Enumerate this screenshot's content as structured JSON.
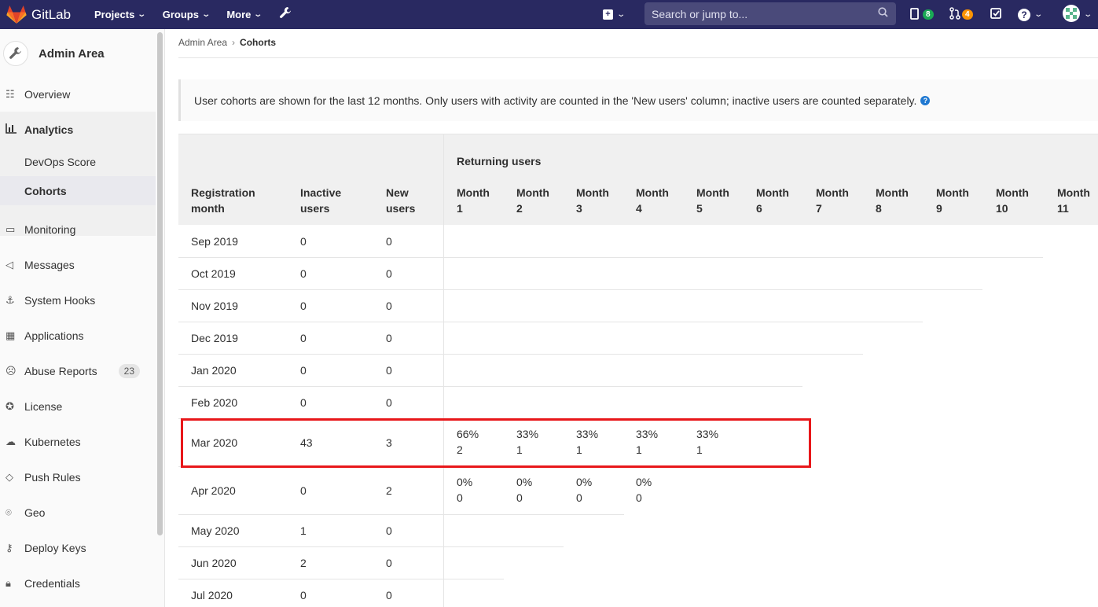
{
  "topbar": {
    "brand": "GitLab",
    "nav": [
      "Projects",
      "Groups",
      "More"
    ],
    "search_placeholder": "Search or jump to...",
    "issues_count": "8",
    "mr_count": "4"
  },
  "sidebar": {
    "title": "Admin Area",
    "items": [
      {
        "label": "Overview",
        "icon": "overview-icon"
      },
      {
        "label": "Analytics",
        "icon": "analytics-icon"
      },
      {
        "label": "Monitoring",
        "icon": "monitor-icon"
      },
      {
        "label": "Messages",
        "icon": "megaphone-icon"
      },
      {
        "label": "System Hooks",
        "icon": "hook-icon"
      },
      {
        "label": "Applications",
        "icon": "applications-icon"
      },
      {
        "label": "Abuse Reports",
        "icon": "abuse-icon",
        "count": "23"
      },
      {
        "label": "License",
        "icon": "license-icon"
      },
      {
        "label": "Kubernetes",
        "icon": "kubernetes-icon"
      },
      {
        "label": "Push Rules",
        "icon": "push-rules-icon"
      },
      {
        "label": "Geo",
        "icon": "geo-icon"
      },
      {
        "label": "Deploy Keys",
        "icon": "key-icon"
      },
      {
        "label": "Credentials",
        "icon": "lock-icon"
      }
    ],
    "analytics_sub": [
      "DevOps Score",
      "Cohorts"
    ]
  },
  "breadcrumb": {
    "parent": "Admin Area",
    "current": "Cohorts"
  },
  "info_text": "User cohorts are shown for the last 12 months. Only users with activity are counted in the 'New users' column; inactive users are counted separately.",
  "table": {
    "col_registration": [
      "Registration",
      "month"
    ],
    "col_inactive": [
      "Inactive",
      "users"
    ],
    "col_new": [
      "New",
      "users"
    ],
    "returning_header": "Returning users",
    "month_headers": [
      [
        "Month",
        "1"
      ],
      [
        "Month",
        "2"
      ],
      [
        "Month",
        "3"
      ],
      [
        "Month",
        "4"
      ],
      [
        "Month",
        "5"
      ],
      [
        "Month",
        "6"
      ],
      [
        "Month",
        "7"
      ],
      [
        "Month",
        "8"
      ],
      [
        "Month",
        "9"
      ],
      [
        "Month",
        "10"
      ],
      [
        "Month",
        "11"
      ]
    ],
    "rows": [
      {
        "month": "Sep 2019",
        "inactive": "0",
        "new": "0",
        "returning": []
      },
      {
        "month": "Oct 2019",
        "inactive": "0",
        "new": "0",
        "returning": []
      },
      {
        "month": "Nov 2019",
        "inactive": "0",
        "new": "0",
        "returning": []
      },
      {
        "month": "Dec 2019",
        "inactive": "0",
        "new": "0",
        "returning": []
      },
      {
        "month": "Jan 2020",
        "inactive": "0",
        "new": "0",
        "returning": []
      },
      {
        "month": "Feb 2020",
        "inactive": "0",
        "new": "0",
        "returning": []
      },
      {
        "month": "Mar 2020",
        "inactive": "43",
        "new": "3",
        "returning": [
          {
            "pct": "66%",
            "count": "2"
          },
          {
            "pct": "33%",
            "count": "1"
          },
          {
            "pct": "33%",
            "count": "1"
          },
          {
            "pct": "33%",
            "count": "1"
          },
          {
            "pct": "33%",
            "count": "1"
          }
        ]
      },
      {
        "month": "Apr 2020",
        "inactive": "0",
        "new": "2",
        "returning": [
          {
            "pct": "0%",
            "count": "0"
          },
          {
            "pct": "0%",
            "count": "0"
          },
          {
            "pct": "0%",
            "count": "0"
          },
          {
            "pct": "0%",
            "count": "0"
          }
        ]
      },
      {
        "month": "May 2020",
        "inactive": "1",
        "new": "0",
        "returning": []
      },
      {
        "month": "Jun 2020",
        "inactive": "2",
        "new": "0",
        "returning": []
      },
      {
        "month": "Jul 2020",
        "inactive": "0",
        "new": "0",
        "returning": []
      }
    ]
  }
}
